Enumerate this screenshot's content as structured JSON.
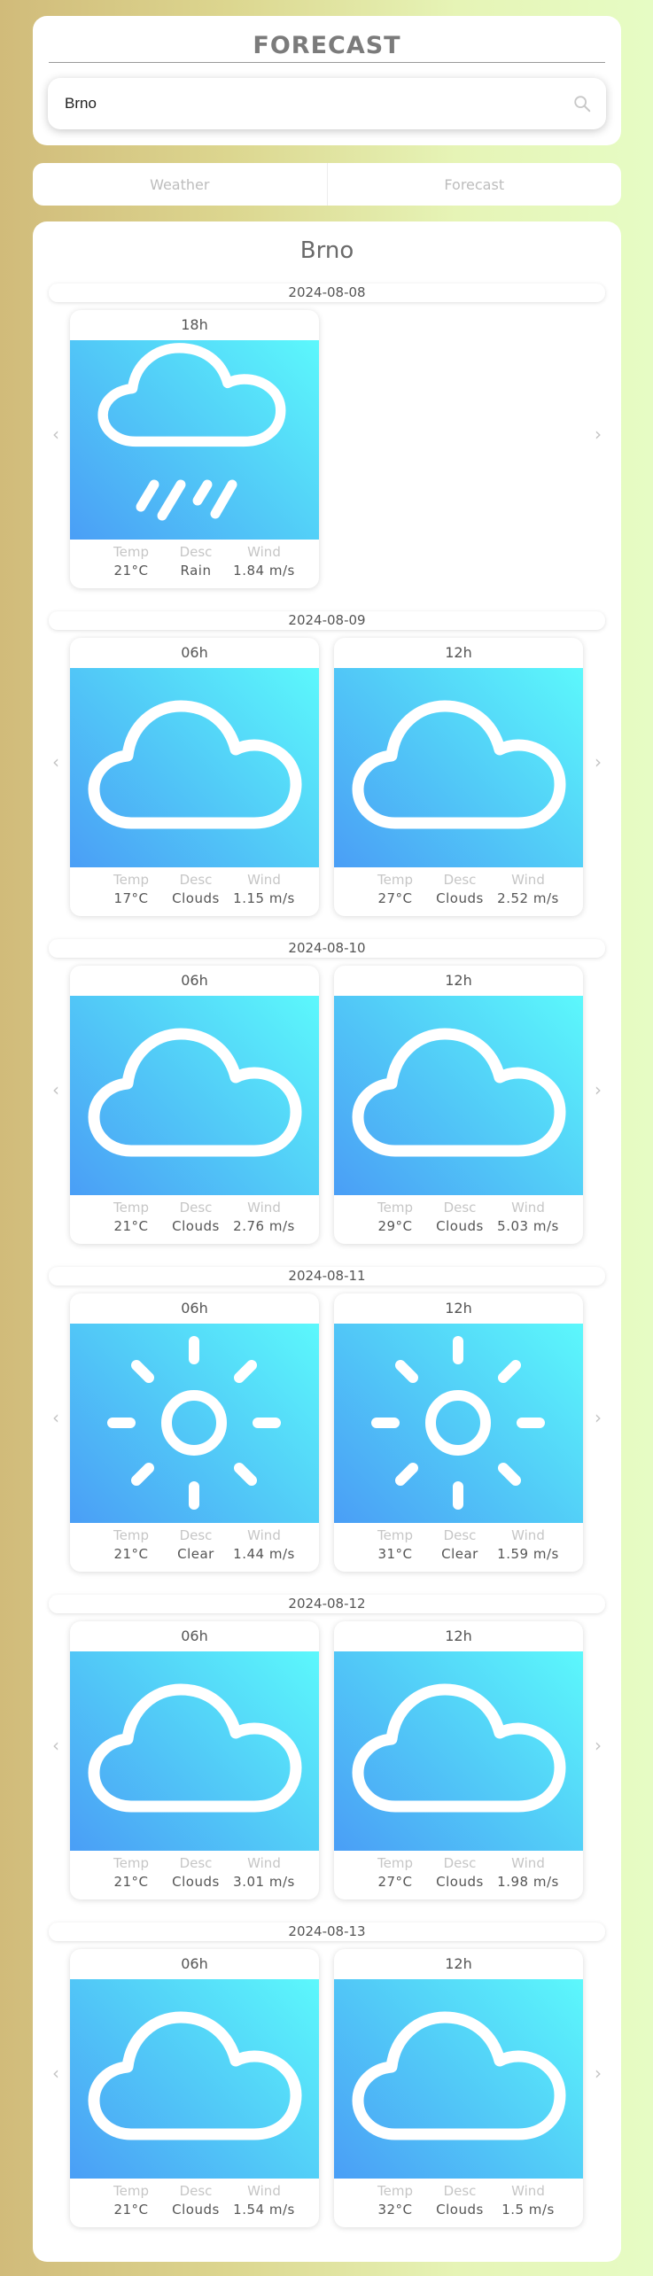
{
  "app": {
    "title": "FORECAST"
  },
  "search": {
    "value": "Brno",
    "icon": "search-icon"
  },
  "tabs": [
    {
      "label": "Weather"
    },
    {
      "label": "Forecast"
    }
  ],
  "main": {
    "city": "Brno",
    "stat_labels": {
      "temp": "Temp",
      "desc": "Desc",
      "wind": "Wind"
    },
    "nav": {
      "prev": "‹",
      "next": "›"
    },
    "days": [
      {
        "date": "2024-08-08",
        "cards": [
          {
            "hour": "18h",
            "icon": "rain-cloud-icon",
            "temp": "21°C",
            "desc": "Rain",
            "wind": "1.84 m/s"
          }
        ]
      },
      {
        "date": "2024-08-09",
        "cards": [
          {
            "hour": "06h",
            "icon": "cloud-icon",
            "temp": "17°C",
            "desc": "Clouds",
            "wind": "1.15 m/s"
          },
          {
            "hour": "12h",
            "icon": "cloud-icon",
            "temp": "27°C",
            "desc": "Clouds",
            "wind": "2.52 m/s"
          }
        ]
      },
      {
        "date": "2024-08-10",
        "cards": [
          {
            "hour": "06h",
            "icon": "cloud-icon",
            "temp": "21°C",
            "desc": "Clouds",
            "wind": "2.76 m/s"
          },
          {
            "hour": "12h",
            "icon": "cloud-icon",
            "temp": "29°C",
            "desc": "Clouds",
            "wind": "5.03 m/s"
          }
        ]
      },
      {
        "date": "2024-08-11",
        "cards": [
          {
            "hour": "06h",
            "icon": "sun-icon",
            "temp": "21°C",
            "desc": "Clear",
            "wind": "1.44 m/s"
          },
          {
            "hour": "12h",
            "icon": "sun-icon",
            "temp": "31°C",
            "desc": "Clear",
            "wind": "1.59 m/s"
          }
        ]
      },
      {
        "date": "2024-08-12",
        "cards": [
          {
            "hour": "06h",
            "icon": "cloud-icon",
            "temp": "21°C",
            "desc": "Clouds",
            "wind": "3.01 m/s"
          },
          {
            "hour": "12h",
            "icon": "cloud-icon",
            "temp": "27°C",
            "desc": "Clouds",
            "wind": "1.98 m/s"
          }
        ]
      },
      {
        "date": "2024-08-13",
        "cards": [
          {
            "hour": "06h",
            "icon": "cloud-icon",
            "temp": "21°C",
            "desc": "Clouds",
            "wind": "1.54 m/s"
          },
          {
            "hour": "12h",
            "icon": "cloud-icon",
            "temp": "32°C",
            "desc": "Clouds",
            "wind": "1.5 m/s"
          }
        ]
      }
    ]
  }
}
